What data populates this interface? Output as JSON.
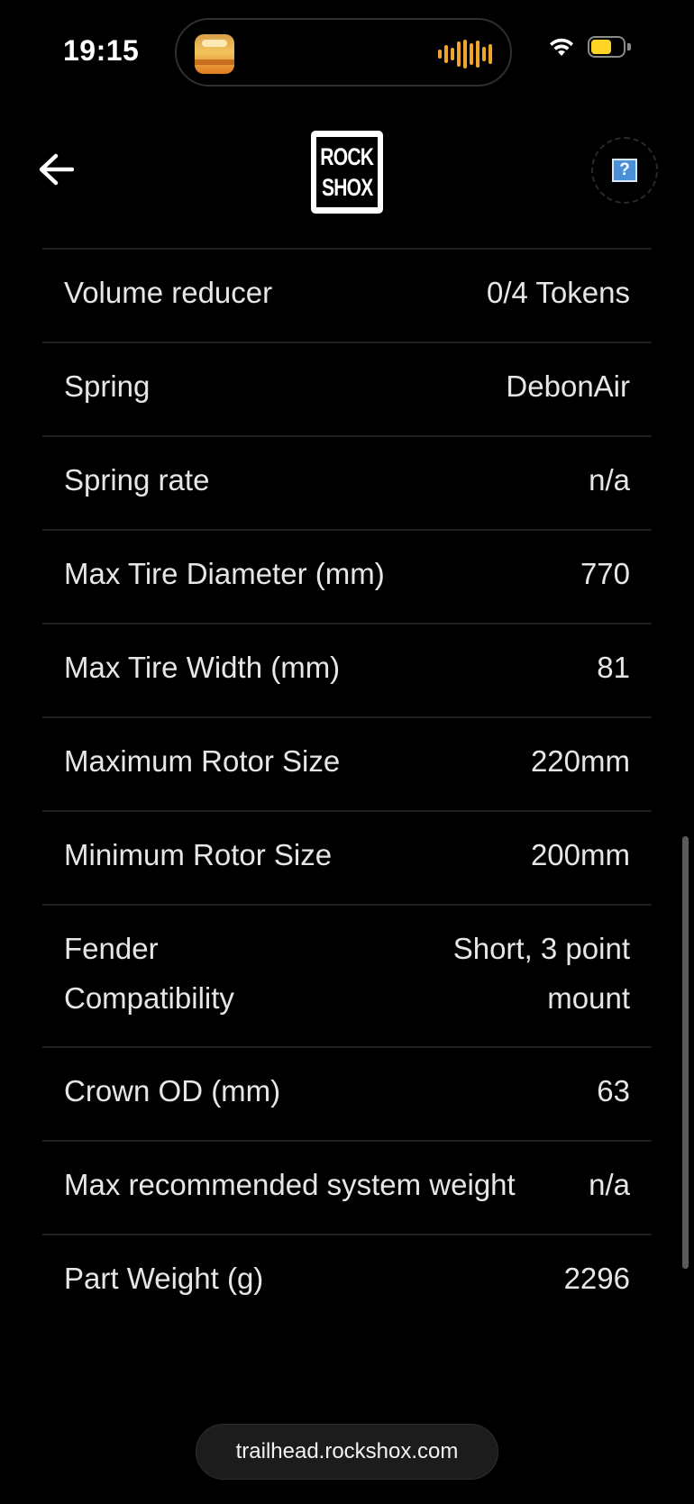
{
  "status_bar": {
    "time": "19:15",
    "battery_color": "#ffd426",
    "waveform_color": "#f0a52a"
  },
  "header": {
    "back_icon": "arrow-left-icon",
    "logo_line1": "ROCK",
    "logo_line2": "SHOX",
    "help_label": "?"
  },
  "specs": [
    {
      "label": "Volume reducer",
      "value": "0/4 Tokens"
    },
    {
      "label": "Spring",
      "value": "DebonAir"
    },
    {
      "label": "Spring rate",
      "value": "n/a"
    },
    {
      "label": "Max Tire Diameter (mm)",
      "value": "770"
    },
    {
      "label": "Max Tire Width (mm)",
      "value": "81"
    },
    {
      "label": "Maximum Rotor Size",
      "value": "220mm"
    },
    {
      "label": "Minimum Rotor Size",
      "value": "200mm"
    },
    {
      "label": "Fender Compatibility",
      "value": "Short, 3 point mount"
    },
    {
      "label": "Crown OD (mm)",
      "value": "63"
    },
    {
      "label": "Max recommended system weight",
      "value": "n/a"
    },
    {
      "label": "Part Weight (g)",
      "value": "2296"
    }
  ],
  "browser": {
    "url": "trailhead.rockshox.com"
  }
}
